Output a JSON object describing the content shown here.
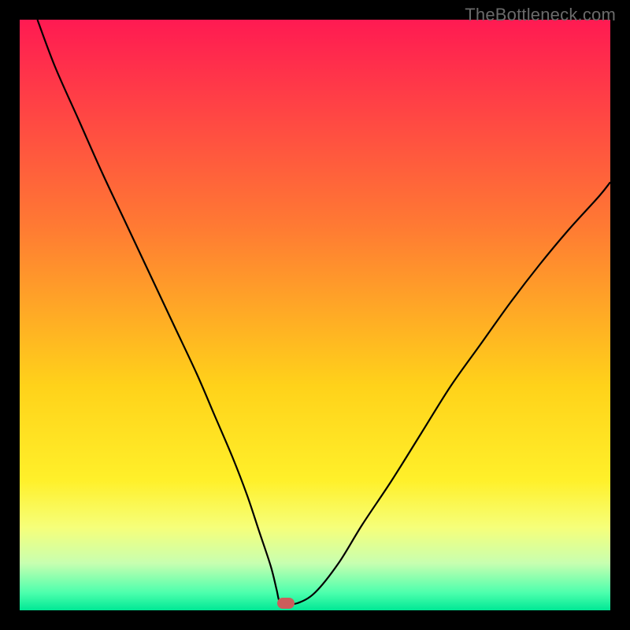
{
  "watermark": "TheBottleneck.com",
  "chart_data": {
    "type": "line",
    "title": "",
    "xlabel": "",
    "ylabel": "",
    "xlim": [
      0,
      100
    ],
    "ylim": [
      0,
      100
    ],
    "grid": false,
    "legend": false,
    "background_gradient": {
      "stops": [
        {
          "offset": 0,
          "color": "#ff1a52"
        },
        {
          "offset": 35,
          "color": "#ff7a33"
        },
        {
          "offset": 62,
          "color": "#ffd21a"
        },
        {
          "offset": 78,
          "color": "#fff02a"
        },
        {
          "offset": 86,
          "color": "#f6ff7a"
        },
        {
          "offset": 92,
          "color": "#c8ffb0"
        },
        {
          "offset": 97,
          "color": "#4dffad"
        },
        {
          "offset": 100,
          "color": "#00e895"
        }
      ]
    },
    "series": [
      {
        "name": "curve",
        "x": [
          3,
          6,
          10,
          14,
          18,
          22,
          26,
          30,
          33,
          36,
          38.5,
          40.5,
          42.5,
          43.5,
          44,
          45,
          47,
          50,
          54,
          58,
          63,
          68,
          73,
          78,
          83,
          88,
          93,
          98,
          100
        ],
        "y": [
          100,
          92,
          83,
          74,
          65.5,
          57,
          48.5,
          40,
          33,
          26,
          19.5,
          13.5,
          7.5,
          3.5,
          1.5,
          1.2,
          1.2,
          3,
          8,
          14.5,
          22,
          30,
          38,
          45,
          52,
          58.5,
          64.5,
          70,
          72.5
        ]
      }
    ],
    "marker": {
      "x": 45,
      "y": 1.2,
      "color": "#cb5d5b"
    }
  }
}
